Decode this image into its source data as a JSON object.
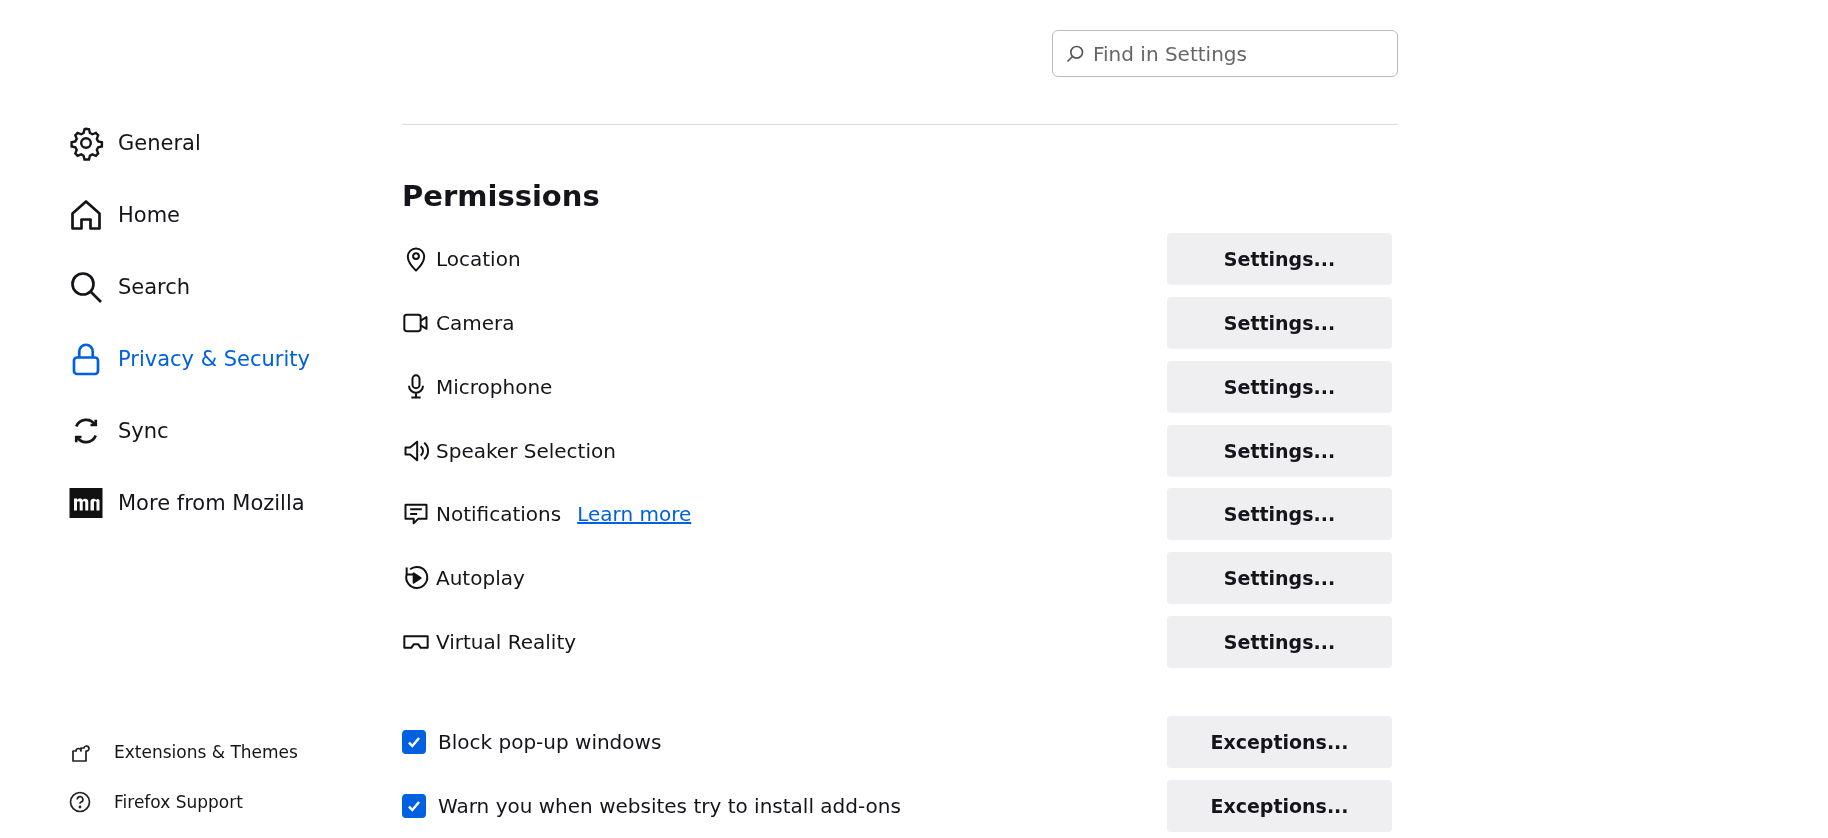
{
  "search": {
    "placeholder": "Find in Settings"
  },
  "sidebar": {
    "items": [
      {
        "label": "General",
        "selected": false
      },
      {
        "label": "Home",
        "selected": false
      },
      {
        "label": "Search",
        "selected": false
      },
      {
        "label": "Privacy & Security",
        "selected": true
      },
      {
        "label": "Sync",
        "selected": false
      },
      {
        "label": "More from Mozilla",
        "selected": false
      }
    ],
    "footer": [
      {
        "label": "Extensions & Themes"
      },
      {
        "label": "Firefox Support"
      }
    ]
  },
  "permissions": {
    "title": "Permissions",
    "items": [
      {
        "label": "Location",
        "button": "Settings..."
      },
      {
        "label": "Camera",
        "button": "Settings..."
      },
      {
        "label": "Microphone",
        "button": "Settings..."
      },
      {
        "label": "Speaker Selection",
        "button": "Settings..."
      },
      {
        "label": "Notifications",
        "link": "Learn more",
        "button": "Settings..."
      },
      {
        "label": "Autoplay",
        "button": "Settings..."
      },
      {
        "label": "Virtual Reality",
        "button": "Settings..."
      }
    ],
    "options": [
      {
        "label": "Block pop-up windows",
        "checked": true,
        "button": "Exceptions..."
      },
      {
        "label": "Warn you when websites try to install add-ons",
        "checked": true,
        "button": "Exceptions..."
      }
    ]
  }
}
